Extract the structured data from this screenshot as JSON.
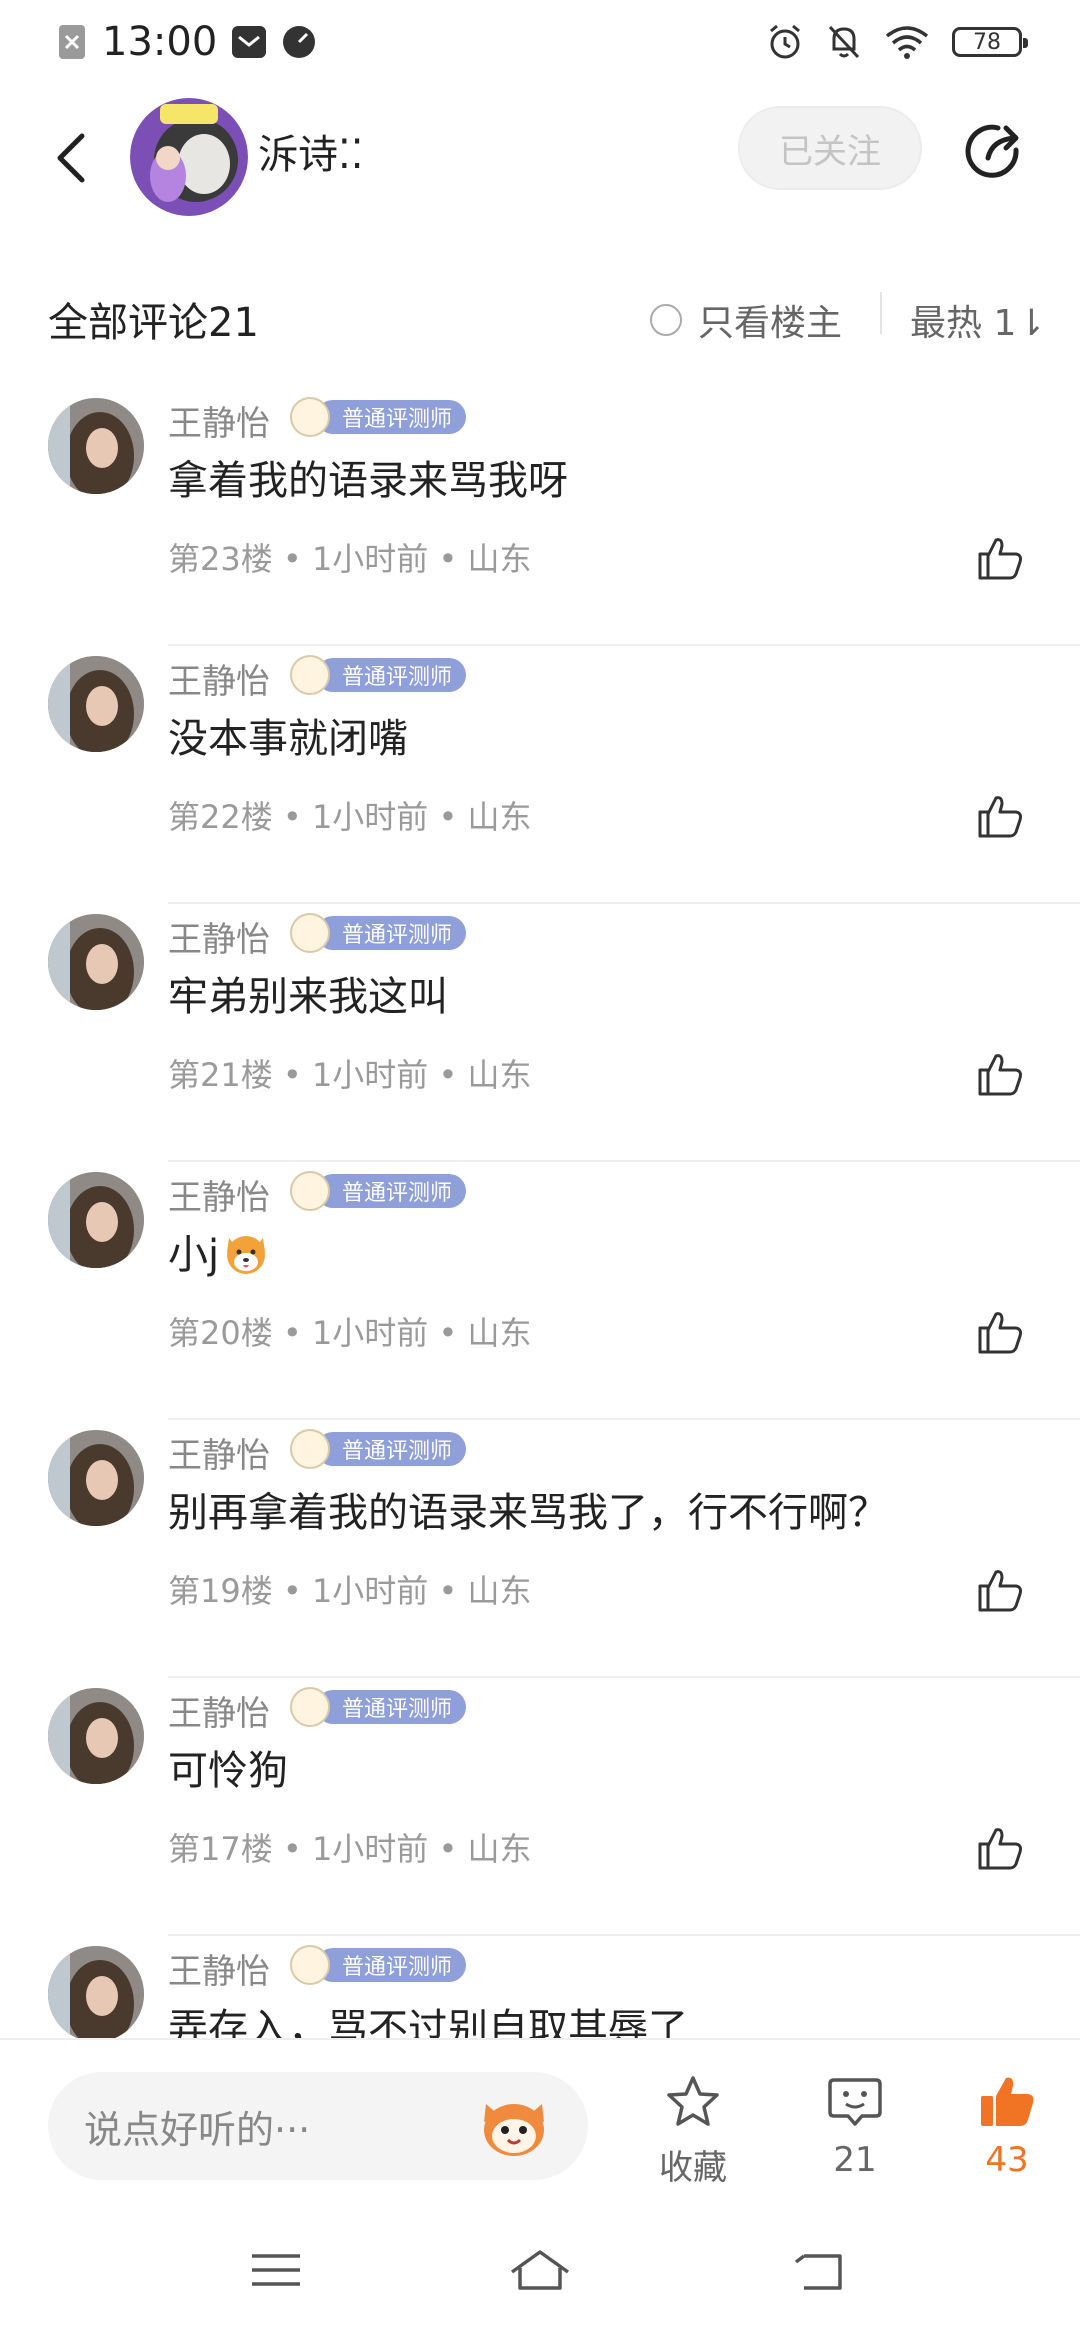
{
  "status_bar": {
    "time": "13:00",
    "battery": "78"
  },
  "header": {
    "username": "泝诗⁚⁚",
    "follow_label": "已关注"
  },
  "comments_header": {
    "title": "全部评论21",
    "only_op_label": "只看楼主",
    "sort_label": "最热 1⇂"
  },
  "comments": [
    {
      "name": "王静怡",
      "badge": "普通评测师",
      "text": "拿着我的语录来骂我呀",
      "meta": "第23楼 • 1小时前 • 山东"
    },
    {
      "name": "王静怡",
      "badge": "普通评测师",
      "text": "没本事就闭嘴",
      "meta": "第22楼 • 1小时前 • 山东"
    },
    {
      "name": "王静怡",
      "badge": "普通评测师",
      "text": "牢弟别来我这叫",
      "meta": "第21楼 • 1小时前 • 山东"
    },
    {
      "name": "王静怡",
      "badge": "普通评测师",
      "text": "小j",
      "emoji": "shiba-dog-emoji",
      "meta": "第20楼 • 1小时前 • 山东"
    },
    {
      "name": "王静怡",
      "badge": "普通评测师",
      "text": "别再拿着我的语录来骂我了，行不行啊？",
      "meta": "第19楼 • 1小时前 • 山东"
    },
    {
      "name": "王静怡",
      "badge": "普通评测师",
      "text": "可怜狗",
      "meta": "第17楼 • 1小时前 • 山东"
    },
    {
      "name": "王静怡",
      "badge": "普通评测师",
      "text": "弄存入，骂不过别自取其辱了",
      "meta": ""
    }
  ],
  "bottom_bar": {
    "input_placeholder": "说点好听的···",
    "favorite_label": "收藏",
    "comment_count": "21",
    "like_count": "43"
  },
  "colors": {
    "accent_orange": "#f07423",
    "badge_blue": "#8f9fd9",
    "meta_gray": "#9a9a9a"
  },
  "icons": [
    "back-icon",
    "share-icon",
    "like-icon",
    "star-icon",
    "comment-icon",
    "thumbs-up-filled-icon",
    "menu-icon",
    "home-icon",
    "return-icon"
  ]
}
